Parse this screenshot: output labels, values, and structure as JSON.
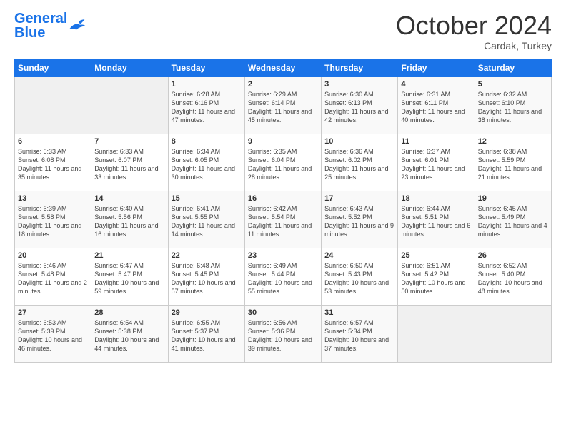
{
  "header": {
    "logo_general": "General",
    "logo_blue": "Blue",
    "month": "October 2024",
    "location": "Cardak, Turkey"
  },
  "weekdays": [
    "Sunday",
    "Monday",
    "Tuesday",
    "Wednesday",
    "Thursday",
    "Friday",
    "Saturday"
  ],
  "weeks": [
    [
      {
        "num": "",
        "info": "",
        "empty": true
      },
      {
        "num": "",
        "info": "",
        "empty": true
      },
      {
        "num": "1",
        "info": "Sunrise: 6:28 AM\nSunset: 6:16 PM\nDaylight: 11 hours and 47 minutes."
      },
      {
        "num": "2",
        "info": "Sunrise: 6:29 AM\nSunset: 6:14 PM\nDaylight: 11 hours and 45 minutes."
      },
      {
        "num": "3",
        "info": "Sunrise: 6:30 AM\nSunset: 6:13 PM\nDaylight: 11 hours and 42 minutes."
      },
      {
        "num": "4",
        "info": "Sunrise: 6:31 AM\nSunset: 6:11 PM\nDaylight: 11 hours and 40 minutes."
      },
      {
        "num": "5",
        "info": "Sunrise: 6:32 AM\nSunset: 6:10 PM\nDaylight: 11 hours and 38 minutes."
      }
    ],
    [
      {
        "num": "6",
        "info": "Sunrise: 6:33 AM\nSunset: 6:08 PM\nDaylight: 11 hours and 35 minutes."
      },
      {
        "num": "7",
        "info": "Sunrise: 6:33 AM\nSunset: 6:07 PM\nDaylight: 11 hours and 33 minutes."
      },
      {
        "num": "8",
        "info": "Sunrise: 6:34 AM\nSunset: 6:05 PM\nDaylight: 11 hours and 30 minutes."
      },
      {
        "num": "9",
        "info": "Sunrise: 6:35 AM\nSunset: 6:04 PM\nDaylight: 11 hours and 28 minutes."
      },
      {
        "num": "10",
        "info": "Sunrise: 6:36 AM\nSunset: 6:02 PM\nDaylight: 11 hours and 25 minutes."
      },
      {
        "num": "11",
        "info": "Sunrise: 6:37 AM\nSunset: 6:01 PM\nDaylight: 11 hours and 23 minutes."
      },
      {
        "num": "12",
        "info": "Sunrise: 6:38 AM\nSunset: 5:59 PM\nDaylight: 11 hours and 21 minutes."
      }
    ],
    [
      {
        "num": "13",
        "info": "Sunrise: 6:39 AM\nSunset: 5:58 PM\nDaylight: 11 hours and 18 minutes."
      },
      {
        "num": "14",
        "info": "Sunrise: 6:40 AM\nSunset: 5:56 PM\nDaylight: 11 hours and 16 minutes."
      },
      {
        "num": "15",
        "info": "Sunrise: 6:41 AM\nSunset: 5:55 PM\nDaylight: 11 hours and 14 minutes."
      },
      {
        "num": "16",
        "info": "Sunrise: 6:42 AM\nSunset: 5:54 PM\nDaylight: 11 hours and 11 minutes."
      },
      {
        "num": "17",
        "info": "Sunrise: 6:43 AM\nSunset: 5:52 PM\nDaylight: 11 hours and 9 minutes."
      },
      {
        "num": "18",
        "info": "Sunrise: 6:44 AM\nSunset: 5:51 PM\nDaylight: 11 hours and 6 minutes."
      },
      {
        "num": "19",
        "info": "Sunrise: 6:45 AM\nSunset: 5:49 PM\nDaylight: 11 hours and 4 minutes."
      }
    ],
    [
      {
        "num": "20",
        "info": "Sunrise: 6:46 AM\nSunset: 5:48 PM\nDaylight: 11 hours and 2 minutes."
      },
      {
        "num": "21",
        "info": "Sunrise: 6:47 AM\nSunset: 5:47 PM\nDaylight: 10 hours and 59 minutes."
      },
      {
        "num": "22",
        "info": "Sunrise: 6:48 AM\nSunset: 5:45 PM\nDaylight: 10 hours and 57 minutes."
      },
      {
        "num": "23",
        "info": "Sunrise: 6:49 AM\nSunset: 5:44 PM\nDaylight: 10 hours and 55 minutes."
      },
      {
        "num": "24",
        "info": "Sunrise: 6:50 AM\nSunset: 5:43 PM\nDaylight: 10 hours and 53 minutes."
      },
      {
        "num": "25",
        "info": "Sunrise: 6:51 AM\nSunset: 5:42 PM\nDaylight: 10 hours and 50 minutes."
      },
      {
        "num": "26",
        "info": "Sunrise: 6:52 AM\nSunset: 5:40 PM\nDaylight: 10 hours and 48 minutes."
      }
    ],
    [
      {
        "num": "27",
        "info": "Sunrise: 6:53 AM\nSunset: 5:39 PM\nDaylight: 10 hours and 46 minutes."
      },
      {
        "num": "28",
        "info": "Sunrise: 6:54 AM\nSunset: 5:38 PM\nDaylight: 10 hours and 44 minutes."
      },
      {
        "num": "29",
        "info": "Sunrise: 6:55 AM\nSunset: 5:37 PM\nDaylight: 10 hours and 41 minutes."
      },
      {
        "num": "30",
        "info": "Sunrise: 6:56 AM\nSunset: 5:36 PM\nDaylight: 10 hours and 39 minutes."
      },
      {
        "num": "31",
        "info": "Sunrise: 6:57 AM\nSunset: 5:34 PM\nDaylight: 10 hours and 37 minutes."
      },
      {
        "num": "",
        "info": "",
        "empty": true
      },
      {
        "num": "",
        "info": "",
        "empty": true
      }
    ]
  ]
}
